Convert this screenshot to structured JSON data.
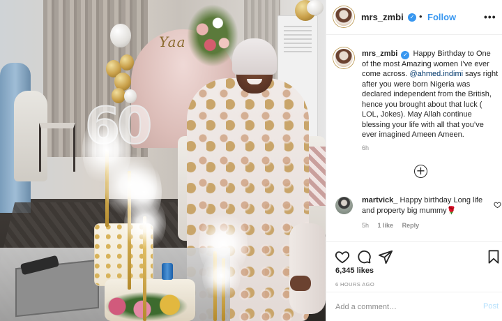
{
  "post_header": {
    "username": "mrs_zmbi",
    "separator": "•",
    "follow_label": "Follow",
    "more_icon": "more-horizontal-icon"
  },
  "photo": {
    "backdrop_text": "Yaa",
    "number_decor": "60"
  },
  "caption": {
    "username": "mrs_zmbi",
    "text_part1": "Happy Birthday to One of the most Amazing women I’ve ever come across. ",
    "mention": "@ahmed.indimi",
    "text_part2": " says right after you were born Nigeria was declared independent from the British, hence you brought about that luck ( LOL, Jokes). May Allah continue blessing your life with all that you’ve ever imagined Ameen Ameen.",
    "time": "6h"
  },
  "load_more_icon": "plus-circle-icon",
  "comments": [
    {
      "username": "martvick_",
      "text": "Happy birthday Long life and property big mummy🌹",
      "time": "5h",
      "likes": "1 like",
      "reply_label": "Reply"
    }
  ],
  "actions": {
    "likes": "6,345 likes",
    "timestamp": "6 HOURS AGO"
  },
  "add_comment": {
    "placeholder": "Add a comment…",
    "post_label": "Post"
  },
  "colors": {
    "link_blue": "#3897f0",
    "mention_blue": "#00376b",
    "secondary_text": "#8e8e8e",
    "post_disabled": "#b2dffc"
  }
}
